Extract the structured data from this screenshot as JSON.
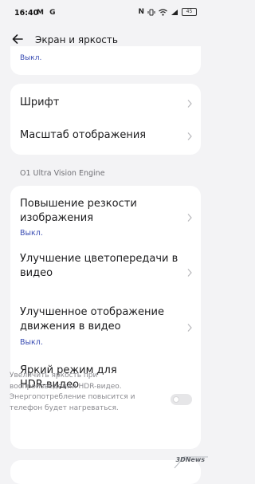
{
  "status_bar": {
    "time": "16:40",
    "left_icons": "M G",
    "right_glyphs": "N",
    "battery": "45"
  },
  "header": {
    "title": "Экран и яркость",
    "back_icon": "arrow-left-icon"
  },
  "top_card": {
    "value": "Выкл."
  },
  "font_card": {
    "items": [
      {
        "label": "Шрифт"
      },
      {
        "label": "Масштаб отображения"
      }
    ]
  },
  "vision_section": {
    "label": "O1 Ultra Vision Engine",
    "items": [
      {
        "label_line1": "Повышение резкости",
        "label_line2": "изображения",
        "value": "Выкл."
      },
      {
        "label_line1": "Улучшение цветопередачи в",
        "label_line2": "видео"
      },
      {
        "label_line1": "Улучшенное отображение",
        "label_line2": "движения в видео",
        "value": "Выкл."
      },
      {
        "label_line1": "Яркий режим для",
        "label_line2": "HDR-видео",
        "description": "Увеличить яркость при воспроизведении HDR-видео. Энергопотребление повысится и телефон будет нагреваться.",
        "toggle_on": false
      }
    ]
  },
  "watermark": "3DNews",
  "colors": {
    "background": "#f3f3f5",
    "card": "#ffffff",
    "accent_value": "#3a4db3",
    "secondary_text": "#8a8a8f"
  }
}
